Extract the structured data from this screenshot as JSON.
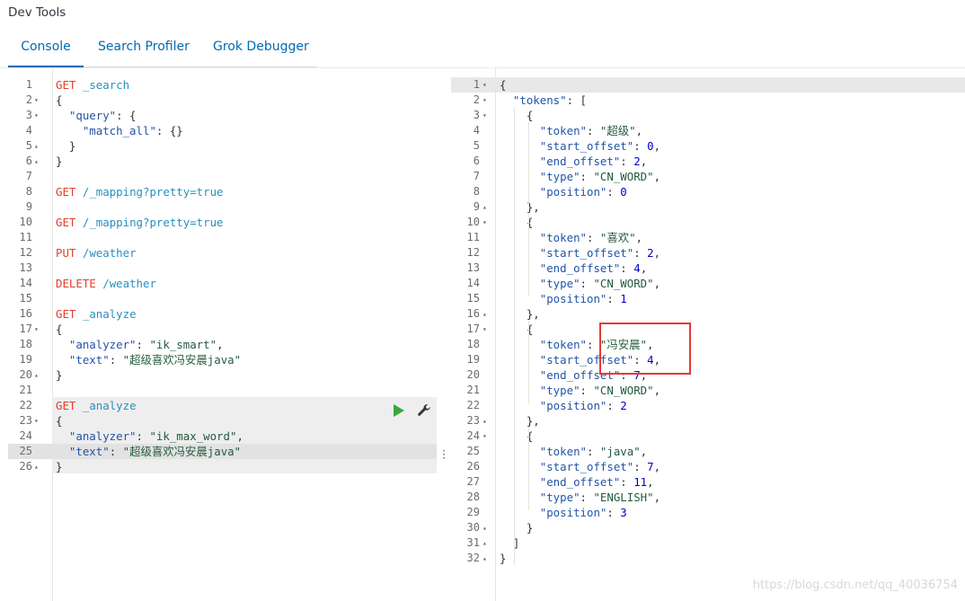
{
  "app": {
    "title": "Dev Tools"
  },
  "tabs": [
    {
      "label": "Console",
      "active": true
    },
    {
      "label": "Search Profiler",
      "active": false
    },
    {
      "label": "Grok Debugger",
      "active": false
    }
  ],
  "request_lines": [
    {
      "n": "1",
      "fold": "",
      "tokens": [
        [
          "m",
          "GET"
        ],
        [
          "p",
          " "
        ],
        [
          "u",
          "_search"
        ]
      ]
    },
    {
      "n": "2",
      "fold": "▾",
      "tokens": [
        [
          "p",
          "{"
        ]
      ]
    },
    {
      "n": "3",
      "fold": "▾",
      "tokens": [
        [
          "p",
          "  "
        ],
        [
          "k",
          "\"query\""
        ],
        [
          "p",
          ": {"
        ]
      ]
    },
    {
      "n": "4",
      "fold": "",
      "tokens": [
        [
          "p",
          "    "
        ],
        [
          "k",
          "\"match_all\""
        ],
        [
          "p",
          ": {}"
        ]
      ]
    },
    {
      "n": "5",
      "fold": "▴",
      "tokens": [
        [
          "p",
          "  }"
        ]
      ]
    },
    {
      "n": "6",
      "fold": "▴",
      "tokens": [
        [
          "p",
          "}"
        ]
      ]
    },
    {
      "n": "7",
      "fold": "",
      "tokens": []
    },
    {
      "n": "8",
      "fold": "",
      "tokens": [
        [
          "m",
          "GET"
        ],
        [
          "p",
          " "
        ],
        [
          "u",
          "/_mapping?pretty=true"
        ]
      ]
    },
    {
      "n": "9",
      "fold": "",
      "tokens": []
    },
    {
      "n": "10",
      "fold": "",
      "tokens": [
        [
          "m",
          "GET"
        ],
        [
          "p",
          " "
        ],
        [
          "u",
          "/_mapping?pretty=true"
        ]
      ]
    },
    {
      "n": "11",
      "fold": "",
      "tokens": []
    },
    {
      "n": "12",
      "fold": "",
      "tokens": [
        [
          "m",
          "PUT"
        ],
        [
          "p",
          " "
        ],
        [
          "u",
          "/weather"
        ]
      ]
    },
    {
      "n": "13",
      "fold": "",
      "tokens": []
    },
    {
      "n": "14",
      "fold": "",
      "tokens": [
        [
          "m",
          "DELETE"
        ],
        [
          "p",
          " "
        ],
        [
          "u",
          "/weather"
        ]
      ]
    },
    {
      "n": "15",
      "fold": "",
      "tokens": []
    },
    {
      "n": "16",
      "fold": "",
      "tokens": [
        [
          "m",
          "GET"
        ],
        [
          "p",
          " "
        ],
        [
          "u",
          "_analyze"
        ]
      ]
    },
    {
      "n": "17",
      "fold": "▾",
      "tokens": [
        [
          "p",
          "{"
        ]
      ]
    },
    {
      "n": "18",
      "fold": "",
      "tokens": [
        [
          "p",
          "  "
        ],
        [
          "k",
          "\"analyzer\""
        ],
        [
          "p",
          ": "
        ],
        [
          "s",
          "\"ik_smart\""
        ],
        [
          "p",
          ","
        ]
      ]
    },
    {
      "n": "19",
      "fold": "",
      "tokens": [
        [
          "p",
          "  "
        ],
        [
          "k",
          "\"text\""
        ],
        [
          "p",
          ": "
        ],
        [
          "s",
          "\"超级喜欢冯安晨java\""
        ]
      ]
    },
    {
      "n": "20",
      "fold": "▴",
      "tokens": [
        [
          "p",
          "}"
        ]
      ]
    },
    {
      "n": "21",
      "fold": "",
      "tokens": []
    },
    {
      "n": "22",
      "fold": "",
      "tokens": [
        [
          "m",
          "GET"
        ],
        [
          "p",
          " "
        ],
        [
          "u",
          "_analyze"
        ]
      ]
    },
    {
      "n": "23",
      "fold": "▾",
      "tokens": [
        [
          "p",
          "{"
        ]
      ]
    },
    {
      "n": "24",
      "fold": "",
      "tokens": [
        [
          "p",
          "  "
        ],
        [
          "k",
          "\"analyzer\""
        ],
        [
          "p",
          ": "
        ],
        [
          "s",
          "\"ik_max_word\""
        ],
        [
          "p",
          ","
        ]
      ]
    },
    {
      "n": "25",
      "fold": "",
      "tokens": [
        [
          "p",
          "  "
        ],
        [
          "k",
          "\"text\""
        ],
        [
          "p",
          ": "
        ],
        [
          "s",
          "\"超级喜欢冯安晨java\""
        ]
      ]
    },
    {
      "n": "26",
      "fold": "▴",
      "tokens": [
        [
          "p",
          "}"
        ]
      ]
    }
  ],
  "response_lines": [
    {
      "n": "1",
      "fold": "▾",
      "tokens": [
        [
          "p",
          "{"
        ]
      ]
    },
    {
      "n": "2",
      "fold": "▾",
      "tokens": [
        [
          "p",
          "  "
        ],
        [
          "k",
          "\"tokens\""
        ],
        [
          "p",
          ": ["
        ]
      ]
    },
    {
      "n": "3",
      "fold": "▾",
      "tokens": [
        [
          "p",
          "    {"
        ]
      ]
    },
    {
      "n": "4",
      "fold": "",
      "tokens": [
        [
          "p",
          "      "
        ],
        [
          "k",
          "\"token\""
        ],
        [
          "p",
          ": "
        ],
        [
          "s",
          "\"超级\""
        ],
        [
          "p",
          ","
        ]
      ]
    },
    {
      "n": "5",
      "fold": "",
      "tokens": [
        [
          "p",
          "      "
        ],
        [
          "k",
          "\"start_offset\""
        ],
        [
          "p",
          ": "
        ],
        [
          "n",
          "0"
        ],
        [
          "p",
          ","
        ]
      ]
    },
    {
      "n": "6",
      "fold": "",
      "tokens": [
        [
          "p",
          "      "
        ],
        [
          "k",
          "\"end_offset\""
        ],
        [
          "p",
          ": "
        ],
        [
          "n",
          "2"
        ],
        [
          "p",
          ","
        ]
      ]
    },
    {
      "n": "7",
      "fold": "",
      "tokens": [
        [
          "p",
          "      "
        ],
        [
          "k",
          "\"type\""
        ],
        [
          "p",
          ": "
        ],
        [
          "s",
          "\"CN_WORD\""
        ],
        [
          "p",
          ","
        ]
      ]
    },
    {
      "n": "8",
      "fold": "",
      "tokens": [
        [
          "p",
          "      "
        ],
        [
          "k",
          "\"position\""
        ],
        [
          "p",
          ": "
        ],
        [
          "n",
          "0"
        ]
      ]
    },
    {
      "n": "9",
      "fold": "▴",
      "tokens": [
        [
          "p",
          "    },"
        ]
      ]
    },
    {
      "n": "10",
      "fold": "▾",
      "tokens": [
        [
          "p",
          "    {"
        ]
      ]
    },
    {
      "n": "11",
      "fold": "",
      "tokens": [
        [
          "p",
          "      "
        ],
        [
          "k",
          "\"token\""
        ],
        [
          "p",
          ": "
        ],
        [
          "s",
          "\"喜欢\""
        ],
        [
          "p",
          ","
        ]
      ]
    },
    {
      "n": "12",
      "fold": "",
      "tokens": [
        [
          "p",
          "      "
        ],
        [
          "k",
          "\"start_offset\""
        ],
        [
          "p",
          ": "
        ],
        [
          "n",
          "2"
        ],
        [
          "p",
          ","
        ]
      ]
    },
    {
      "n": "13",
      "fold": "",
      "tokens": [
        [
          "p",
          "      "
        ],
        [
          "k",
          "\"end_offset\""
        ],
        [
          "p",
          ": "
        ],
        [
          "n",
          "4"
        ],
        [
          "p",
          ","
        ]
      ]
    },
    {
      "n": "14",
      "fold": "",
      "tokens": [
        [
          "p",
          "      "
        ],
        [
          "k",
          "\"type\""
        ],
        [
          "p",
          ": "
        ],
        [
          "s",
          "\"CN_WORD\""
        ],
        [
          "p",
          ","
        ]
      ]
    },
    {
      "n": "15",
      "fold": "",
      "tokens": [
        [
          "p",
          "      "
        ],
        [
          "k",
          "\"position\""
        ],
        [
          "p",
          ": "
        ],
        [
          "n",
          "1"
        ]
      ]
    },
    {
      "n": "16",
      "fold": "▴",
      "tokens": [
        [
          "p",
          "    },"
        ]
      ]
    },
    {
      "n": "17",
      "fold": "▾",
      "tokens": [
        [
          "p",
          "    {"
        ]
      ]
    },
    {
      "n": "18",
      "fold": "",
      "tokens": [
        [
          "p",
          "      "
        ],
        [
          "k",
          "\"token\""
        ],
        [
          "p",
          ": "
        ],
        [
          "s",
          "\"冯安晨\""
        ],
        [
          "p",
          ","
        ]
      ]
    },
    {
      "n": "19",
      "fold": "",
      "tokens": [
        [
          "p",
          "      "
        ],
        [
          "k",
          "\"start_offset\""
        ],
        [
          "p",
          ": "
        ],
        [
          "n",
          "4"
        ],
        [
          "p",
          ","
        ]
      ]
    },
    {
      "n": "20",
      "fold": "",
      "tokens": [
        [
          "p",
          "      "
        ],
        [
          "k",
          "\"end_offset\""
        ],
        [
          "p",
          ": "
        ],
        [
          "n",
          "7"
        ],
        [
          "p",
          ","
        ]
      ]
    },
    {
      "n": "21",
      "fold": "",
      "tokens": [
        [
          "p",
          "      "
        ],
        [
          "k",
          "\"type\""
        ],
        [
          "p",
          ": "
        ],
        [
          "s",
          "\"CN_WORD\""
        ],
        [
          "p",
          ","
        ]
      ]
    },
    {
      "n": "22",
      "fold": "",
      "tokens": [
        [
          "p",
          "      "
        ],
        [
          "k",
          "\"position\""
        ],
        [
          "p",
          ": "
        ],
        [
          "n",
          "2"
        ]
      ]
    },
    {
      "n": "23",
      "fold": "▴",
      "tokens": [
        [
          "p",
          "    },"
        ]
      ]
    },
    {
      "n": "24",
      "fold": "▾",
      "tokens": [
        [
          "p",
          "    {"
        ]
      ]
    },
    {
      "n": "25",
      "fold": "",
      "tokens": [
        [
          "p",
          "      "
        ],
        [
          "k",
          "\"token\""
        ],
        [
          "p",
          ": "
        ],
        [
          "s",
          "\"java\""
        ],
        [
          "p",
          ","
        ]
      ]
    },
    {
      "n": "26",
      "fold": "",
      "tokens": [
        [
          "p",
          "      "
        ],
        [
          "k",
          "\"start_offset\""
        ],
        [
          "p",
          ": "
        ],
        [
          "n",
          "7"
        ],
        [
          "p",
          ","
        ]
      ]
    },
    {
      "n": "27",
      "fold": "",
      "tokens": [
        [
          "p",
          "      "
        ],
        [
          "k",
          "\"end_offset\""
        ],
        [
          "p",
          ": "
        ],
        [
          "n",
          "11"
        ],
        [
          "p",
          ","
        ]
      ]
    },
    {
      "n": "28",
      "fold": "",
      "tokens": [
        [
          "p",
          "      "
        ],
        [
          "k",
          "\"type\""
        ],
        [
          "p",
          ": "
        ],
        [
          "s",
          "\"ENGLISH\""
        ],
        [
          "p",
          ","
        ]
      ]
    },
    {
      "n": "29",
      "fold": "",
      "tokens": [
        [
          "p",
          "      "
        ],
        [
          "k",
          "\"position\""
        ],
        [
          "p",
          ": "
        ],
        [
          "n",
          "3"
        ]
      ]
    },
    {
      "n": "30",
      "fold": "▴",
      "tokens": [
        [
          "p",
          "    }"
        ]
      ]
    },
    {
      "n": "31",
      "fold": "▴",
      "tokens": [
        [
          "p",
          "  ]"
        ]
      ]
    },
    {
      "n": "32",
      "fold": "▴",
      "tokens": [
        [
          "p",
          "}"
        ]
      ]
    }
  ],
  "icons": {
    "run": "play-icon",
    "settings": "wrench-icon",
    "divider": "drag-handle-icon"
  },
  "watermark": "https://blog.csdn.net/qq_40036754",
  "colors": {
    "method": "#e03e2d",
    "url": "#2a8fbd",
    "key": "#2154a7",
    "string": "#225b3e",
    "number": "#0000cd",
    "tab_active": "#006bb4",
    "highlight_box": "#e53935"
  }
}
